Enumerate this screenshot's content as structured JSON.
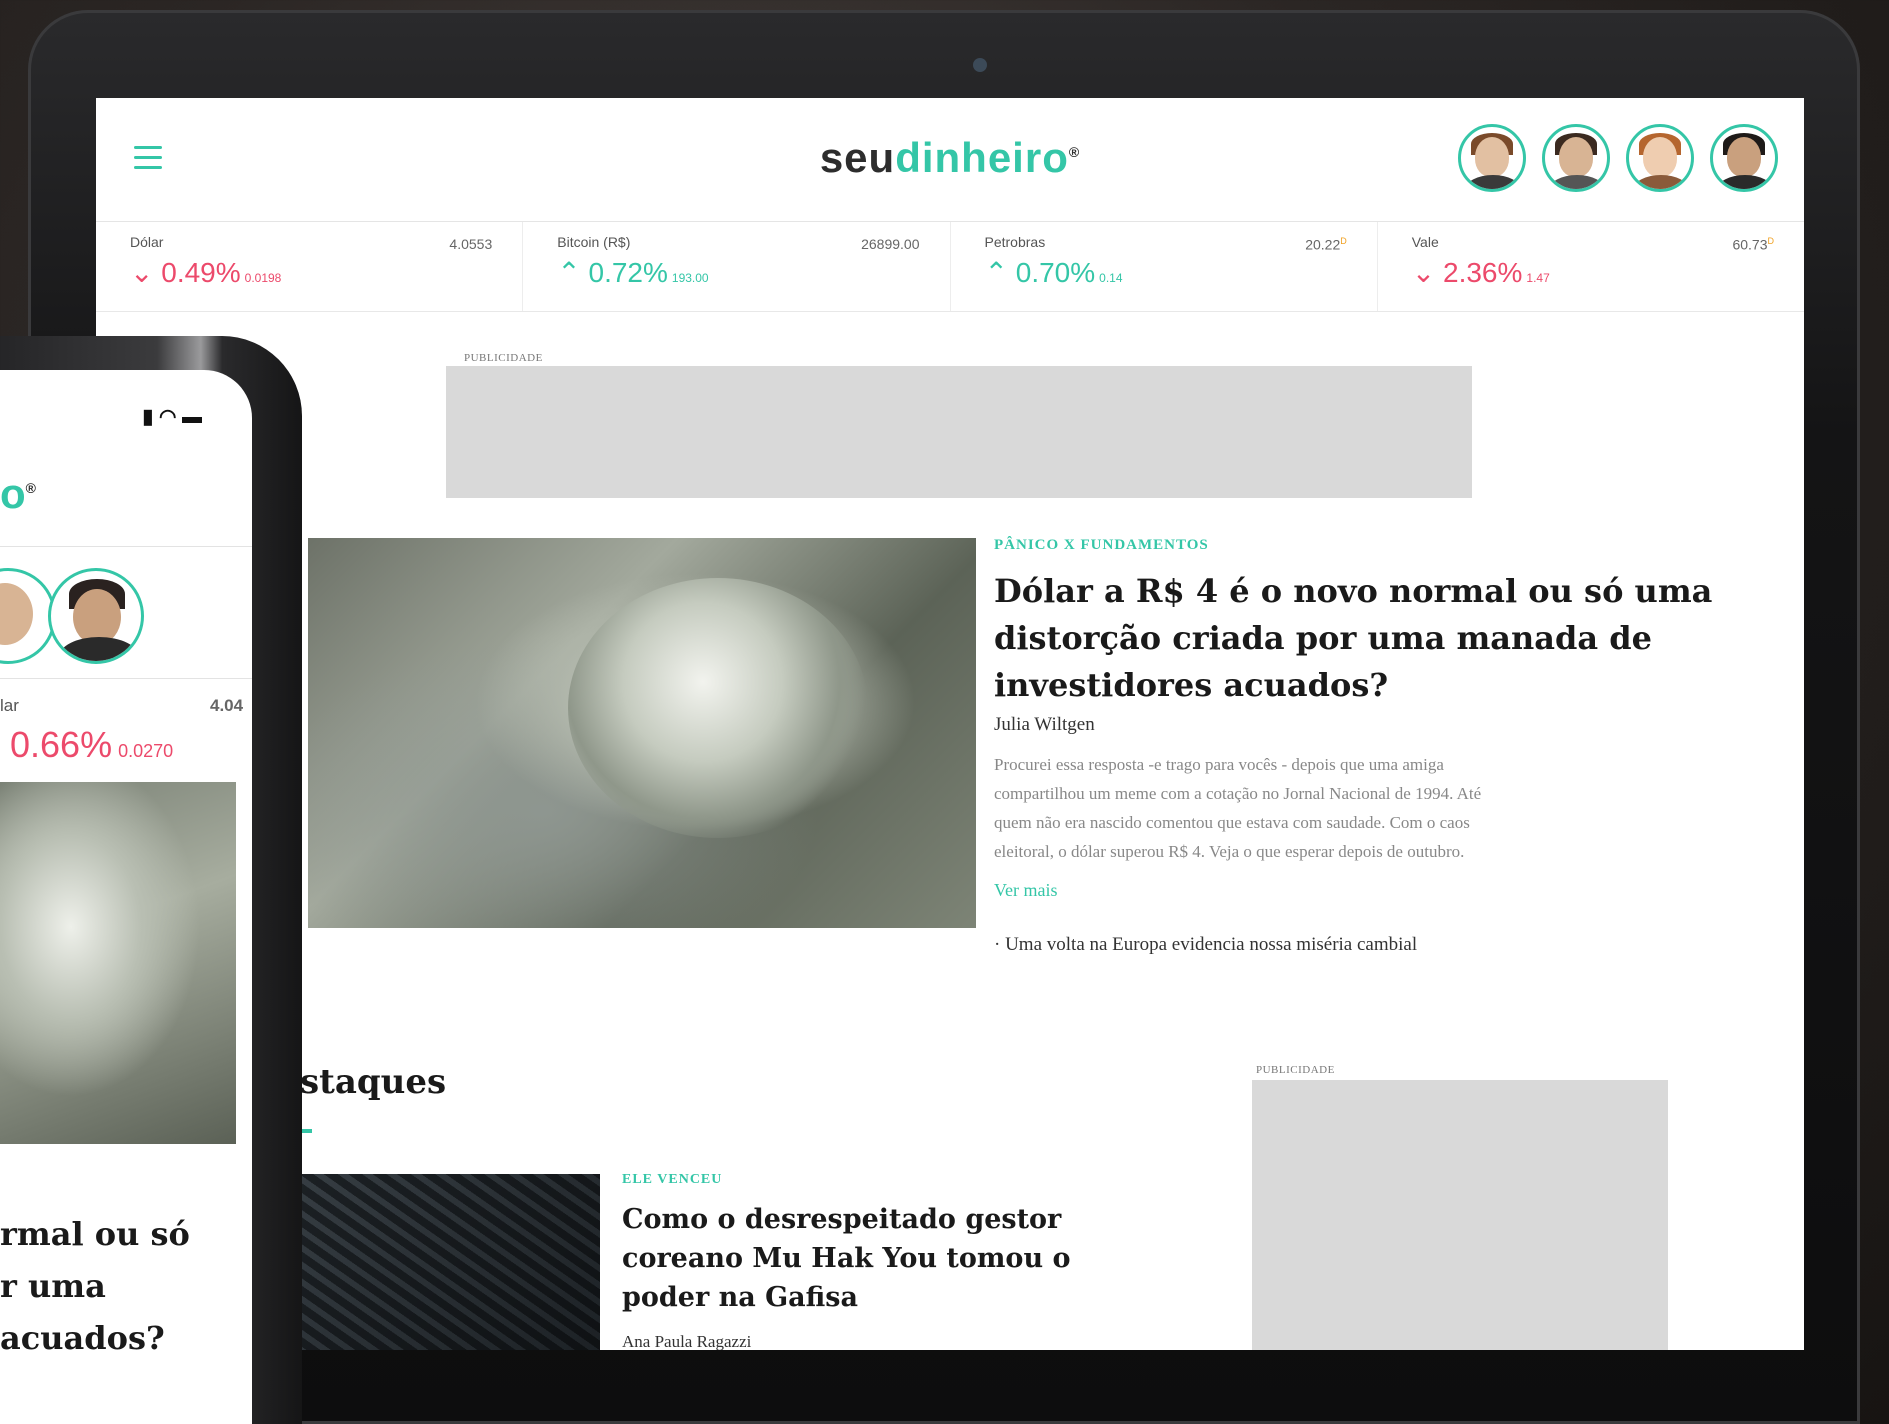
{
  "header": {
    "logo_part1": "seu",
    "logo_part2": "dinheiro",
    "logo_mark": "®"
  },
  "ticker": [
    {
      "name": "Dólar",
      "price": "4.0553",
      "direction": "down",
      "arrow": "⌄",
      "pct": "0.49%",
      "change": "0.0198"
    },
    {
      "name": "Bitcoin (R$)",
      "price": "26899.00",
      "direction": "up",
      "arrow": "⌃",
      "pct": "0.72%",
      "change": "193.00"
    },
    {
      "name": "Petrobras",
      "price": "20.22",
      "flag": "D",
      "direction": "up",
      "arrow": "⌃",
      "pct": "0.70%",
      "change": "0.14"
    },
    {
      "name": "Vale",
      "price": "60.73",
      "flag": "D",
      "direction": "down",
      "arrow": "⌄",
      "pct": "2.36%",
      "change": "1.47"
    }
  ],
  "ads": {
    "label": "PUBLICIDADE"
  },
  "featured": {
    "kicker": "PÂNICO X FUNDAMENTOS",
    "headline_lines": [
      "Dólar a R$ 4 é o novo normal ou só uma",
      "distorção criada por uma manada de",
      "investidores acuados?"
    ],
    "author": "Julia Wiltgen",
    "excerpt_lines": [
      "Procurei essa resposta -e trago para vocês - depois que uma amiga",
      "compartilhou um meme com a cotação no Jornal Nacional de 1994. Até",
      "quem não era nascido comentou que estava com saudade. Com o caos",
      "eleitoral, o dólar superou R$ 4. Veja o que esperar depois de outubro."
    ],
    "more_link": "Ver mais",
    "related": "· Uma volta na Europa evidencia nossa miséria cambial"
  },
  "highlights": {
    "section_title": "staques",
    "kicker": "ELE VENCEU",
    "headline_lines": [
      "Como o desrespeitado gestor",
      "coreano Mu Hak You tomou o",
      "poder na Gafisa"
    ],
    "author": "Ana Paula Ragazzi"
  },
  "phone": {
    "logo": "o",
    "logo_mark": "®",
    "ticker_name": "lar",
    "ticker_price": "4.04",
    "ticker_pct": "0.66%",
    "ticker_change": "0.0270",
    "headline_lines": [
      "rmal ou só",
      "r uma",
      "acuados?"
    ]
  },
  "colors": {
    "accent": "#34c6a7",
    "negative": "#ec4a6b",
    "ad_placeholder": "#d9d9d9"
  }
}
